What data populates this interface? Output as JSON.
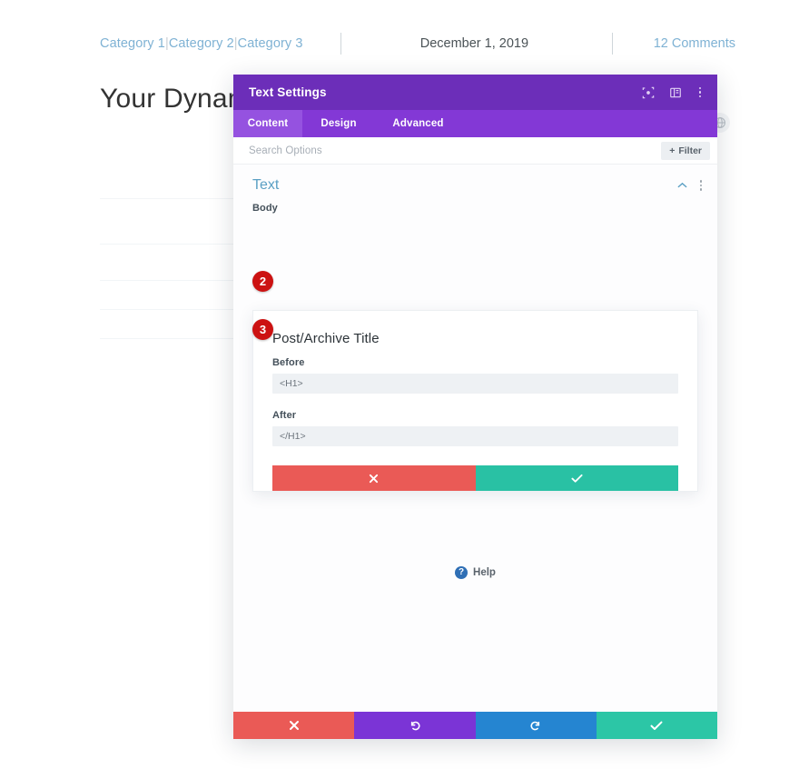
{
  "page": {
    "categories": [
      "Category 1",
      "Category 2",
      "Category 3"
    ],
    "category_separator": "|",
    "date": "December 1, 2019",
    "comments": "12 Comments",
    "title": "Your Dynamic",
    "globe_icon": "globe-icon"
  },
  "modal": {
    "title": "Text Settings",
    "header_icons": [
      "focus-target-icon",
      "panel-layout-icon",
      "kebab-menu-icon"
    ],
    "tabs": [
      {
        "label": "Content",
        "active": true
      },
      {
        "label": "Design",
        "active": false
      },
      {
        "label": "Advanced",
        "active": false
      }
    ],
    "search": {
      "placeholder": "Search Options",
      "filter_label": "Filter",
      "filter_icon": "plus-icon"
    },
    "section": {
      "title": "Text",
      "collapse_icon": "chevron-up-icon",
      "menu_icon": "kebab-menu-icon"
    },
    "body_field_label": "Body",
    "dynamic_popup": {
      "heading": "Post/Archive Title",
      "before_label": "Before",
      "before_value": "<H1>",
      "after_label": "After",
      "after_value": "</H1>",
      "cancel_icon": "x-icon",
      "confirm_icon": "check-icon"
    },
    "badges": [
      {
        "number": "2",
        "target": "before-input"
      },
      {
        "number": "3",
        "target": "after-input"
      }
    ],
    "help": {
      "label": "Help",
      "icon": "question-mark-icon"
    },
    "footer": [
      {
        "name": "close",
        "icon": "x-icon",
        "color": "#ea5a56"
      },
      {
        "name": "undo",
        "icon": "undo-arrow-icon",
        "color": "#7b34d6"
      },
      {
        "name": "redo",
        "icon": "redo-arrow-icon",
        "color": "#2585d1"
      },
      {
        "name": "save",
        "icon": "check-icon",
        "color": "#2cc6a6"
      }
    ]
  },
  "colors": {
    "modal_header": "#6c2eb9",
    "modal_tabs": "#8338d6",
    "tab_active": "#9552e0",
    "badge_red": "#cc1212",
    "accent_teal": "#29c1a4",
    "accent_red": "#ea5a56",
    "link_blue": "#7fb2d4",
    "section_blue": "#5ba0c4"
  }
}
